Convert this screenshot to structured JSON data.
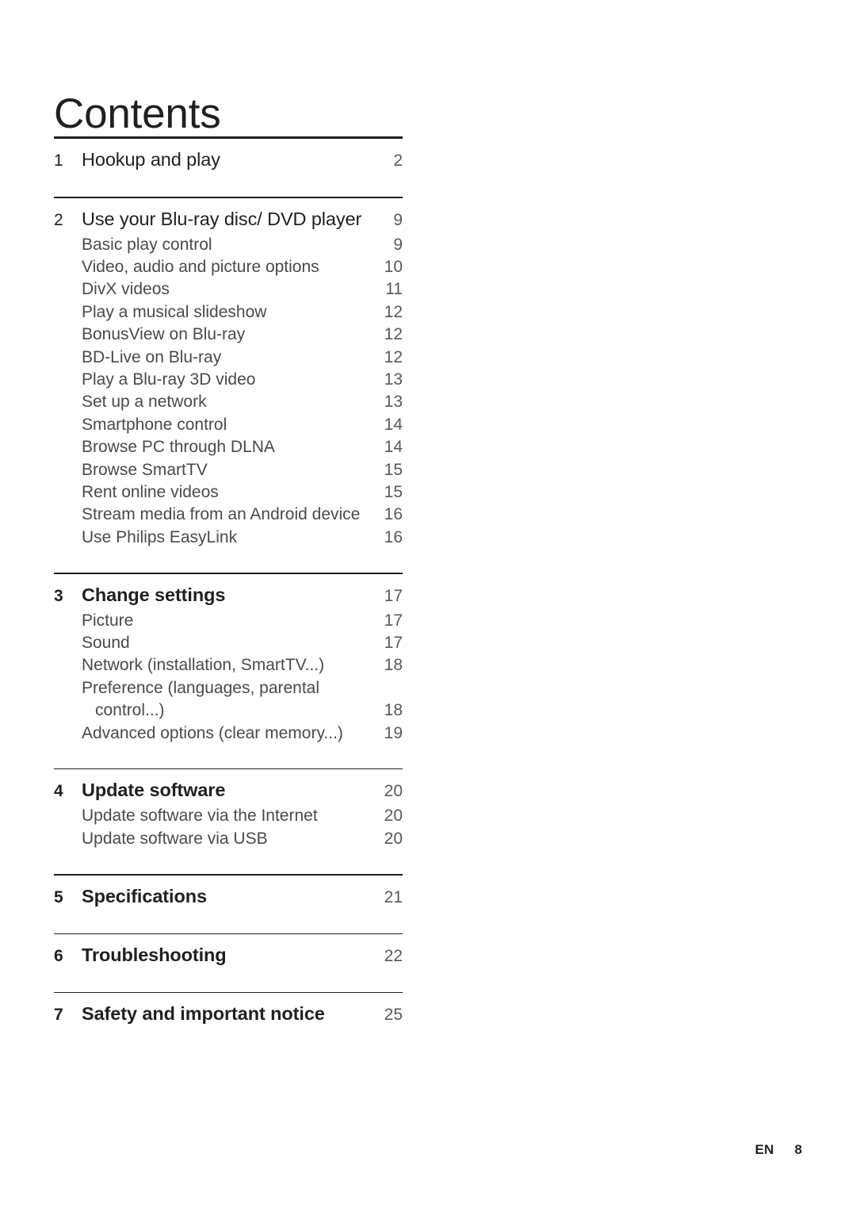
{
  "document": {
    "title": "Contents"
  },
  "footer": {
    "language": "EN",
    "page_number": "8"
  },
  "toc": {
    "sections": [
      {
        "number": "1",
        "title": "Hookup and play",
        "page": "2",
        "bold": false,
        "rule": "thick",
        "entries": []
      },
      {
        "number": "2",
        "title": "Use your Blu-ray disc/ DVD player",
        "page": "9",
        "bold": false,
        "rule": "thin",
        "entries": [
          {
            "title": "Basic play control",
            "page": "9"
          },
          {
            "title": "Video, audio and picture options",
            "page": "10"
          },
          {
            "title": "DivX videos",
            "page": "11"
          },
          {
            "title": "Play a musical slideshow",
            "page": "12"
          },
          {
            "title": "BonusView on Blu-ray",
            "page": "12"
          },
          {
            "title": "BD-Live on Blu-ray",
            "page": "12"
          },
          {
            "title": "Play a Blu-ray 3D video",
            "page": "13"
          },
          {
            "title": "Set up a network",
            "page": "13"
          },
          {
            "title": "Smartphone control",
            "page": "14"
          },
          {
            "title": "Browse PC through DLNA",
            "page": "14"
          },
          {
            "title": "Browse SmartTV",
            "page": "15"
          },
          {
            "title": "Rent online videos",
            "page": "15"
          },
          {
            "title": "Stream media from an Android device",
            "page": "16"
          },
          {
            "title": "Use Philips EasyLink",
            "page": "16"
          }
        ]
      },
      {
        "number": "3",
        "title": "Change settings",
        "page": "17",
        "bold": true,
        "rule": "thin",
        "entries": [
          {
            "title": "Picture",
            "page": "17"
          },
          {
            "title": "Sound",
            "page": "17"
          },
          {
            "title": "Network (installation, SmartTV...)",
            "page": "18"
          },
          {
            "title": "Preference (languages, parental",
            "page": "",
            "continues": true
          },
          {
            "title": "control...)",
            "page": "18",
            "continuation": true
          },
          {
            "title": "Advanced options (clear memory...)",
            "page": "19"
          }
        ]
      },
      {
        "number": "4",
        "title": "Update software",
        "page": "20",
        "bold": true,
        "rule": "thin",
        "entries": [
          {
            "title": "Update software via the Internet",
            "page": "20"
          },
          {
            "title": "Update software via USB",
            "page": "20"
          }
        ]
      },
      {
        "number": "5",
        "title": "Specifications",
        "page": "21",
        "bold": true,
        "rule": "thin",
        "entries": []
      },
      {
        "number": "6",
        "title": "Troubleshooting",
        "page": "22",
        "bold": true,
        "rule": "thin",
        "entries": []
      },
      {
        "number": "7",
        "title": "Safety and important notice",
        "page": "25",
        "bold": true,
        "rule": "thin",
        "entries": []
      }
    ]
  }
}
